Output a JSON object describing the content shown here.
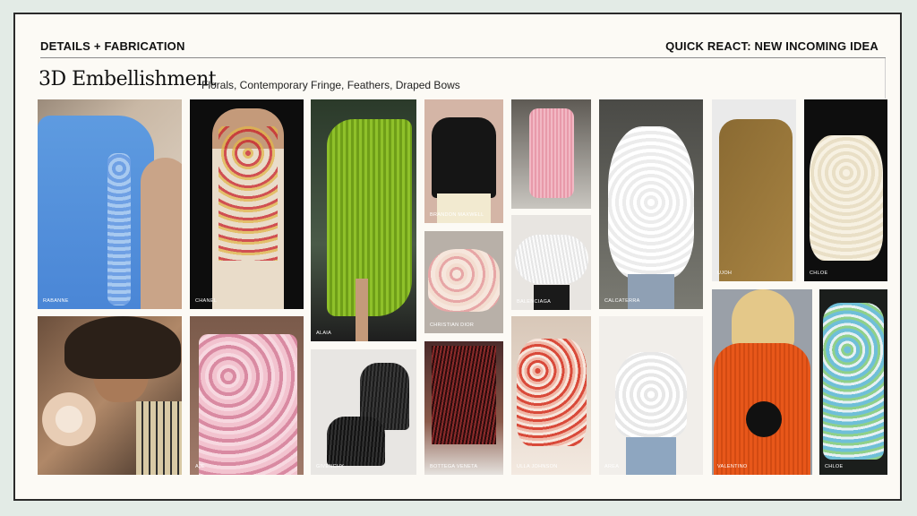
{
  "header": {
    "left": "DETAILS + FABRICATION",
    "right": "QUICK REACT: NEW INCOMING IDEA"
  },
  "title": "3D Embellishment",
  "subtitle": "Florals, Contemporary Fringe, Feathers, Draped Bows",
  "colors": {
    "background": "#e3ebe6",
    "slide": "#fcfaf5",
    "text": "#111111"
  },
  "photos": [
    {
      "label": "RABANNE",
      "description": "blue dress with 3D floral appliqué"
    },
    {
      "label": "CHANEL",
      "description": "floral embellished gown"
    },
    {
      "label": "ALAIA",
      "description": "lime fringe skirt"
    },
    {
      "label": "BRANDON MAXWELL",
      "description": "black feather top"
    },
    {
      "label": "CHRISTIAN DIOR",
      "description": "floral ruffle skirt"
    },
    {
      "label": "BOTTEGA VENETA",
      "description": "fringe skirt"
    },
    {
      "label": "",
      "description": "pink fringe dress"
    },
    {
      "label": "BALENCIAGA",
      "description": "white feather top"
    },
    {
      "label": "ULLA JOHNSON",
      "description": "floral ruffle dress"
    },
    {
      "label": "CALCATERRA",
      "description": "white feather dress"
    },
    {
      "label": "AREA",
      "description": "white feather top"
    },
    {
      "label": "UJOH",
      "description": "draped bow jumpsuit"
    },
    {
      "label": "VALENTINO",
      "description": "orange knit with bow"
    },
    {
      "label": "CHLOE",
      "description": "ruffle off-shoulder dress with bow"
    },
    {
      "label": "CHLOE",
      "description": "floral draped dress"
    },
    {
      "label": "",
      "description": "floral pin brooch"
    },
    {
      "label": "AJE",
      "description": "pink sequin floral dress"
    },
    {
      "label": "GIVENCHY",
      "description": "black fringe shoes"
    }
  ]
}
